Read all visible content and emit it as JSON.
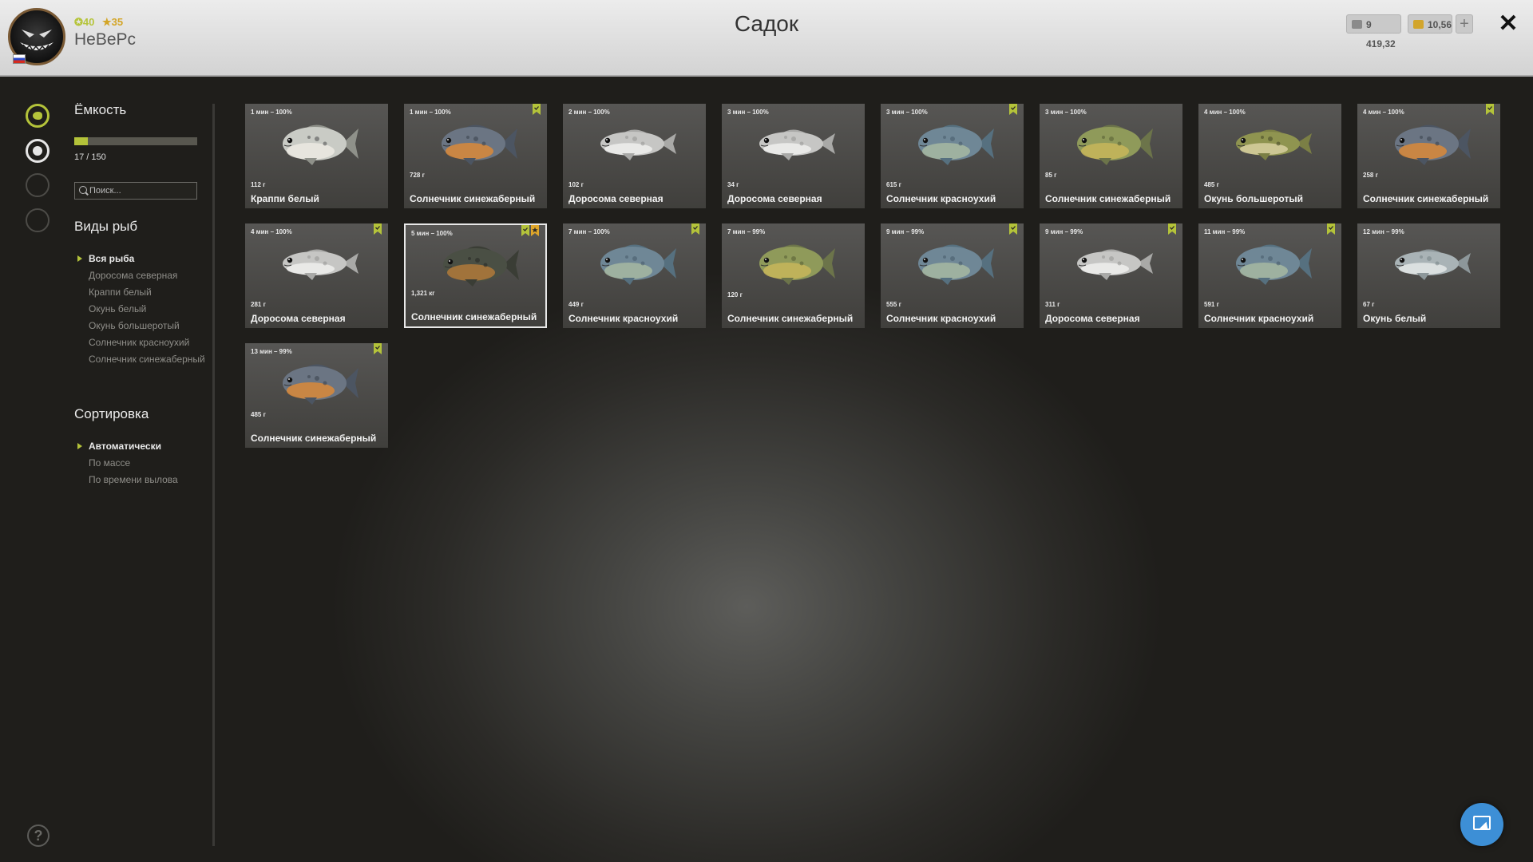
{
  "header": {
    "title": "Садок",
    "player": {
      "name": "НеВеРс",
      "level": "40",
      "rank": "35"
    },
    "currency": {
      "silver": "9 419,32",
      "gold": "10,56"
    },
    "add_label": "+",
    "close_label": "✕"
  },
  "sidebar": {
    "capacity": {
      "title": "Ёмкость",
      "text": "17 / 150",
      "fraction": 0.113
    },
    "search_placeholder": "Поиск...",
    "species": {
      "title": "Виды рыб",
      "items": [
        {
          "label": "Вся рыба",
          "active": true
        },
        {
          "label": "Доросома северная",
          "active": false
        },
        {
          "label": "Краппи белый",
          "active": false
        },
        {
          "label": "Окунь белый",
          "active": false
        },
        {
          "label": "Окунь большеротый",
          "active": false
        },
        {
          "label": "Солнечник красноухий",
          "active": false
        },
        {
          "label": "Солнечник синежаберный",
          "active": false
        }
      ]
    },
    "sort": {
      "title": "Сортировка",
      "items": [
        {
          "label": "Автоматически",
          "active": true
        },
        {
          "label": "По массе",
          "active": false
        },
        {
          "label": "По времени вылова",
          "active": false
        }
      ]
    },
    "help_label": "?"
  },
  "catch": [
    {
      "time": "1 мин – 100%",
      "weight": "112 г",
      "name": "Краппи белый",
      "kind": "crappie",
      "trophy": false,
      "star": false
    },
    {
      "time": "1 мин – 100%",
      "weight": "728 г",
      "name": "Солнечник синежаберный",
      "kind": "bluegill",
      "trophy": true,
      "star": false
    },
    {
      "time": "2 мин – 100%",
      "weight": "102 г",
      "name": "Доросома северная",
      "kind": "shad",
      "trophy": false,
      "star": false
    },
    {
      "time": "3 мин – 100%",
      "weight": "34 г",
      "name": "Доросома северная",
      "kind": "shad",
      "trophy": false,
      "star": false
    },
    {
      "time": "3 мин – 100%",
      "weight": "615 г",
      "name": "Солнечник красноухий",
      "kind": "redear",
      "trophy": true,
      "star": false
    },
    {
      "time": "3 мин – 100%",
      "weight": "85 г",
      "name": "Солнечник синежаберный",
      "kind": "bluegill-green",
      "trophy": false,
      "star": false
    },
    {
      "time": "4 мин – 100%",
      "weight": "485 г",
      "name": "Окунь большеротый",
      "kind": "bass",
      "trophy": false,
      "star": false
    },
    {
      "time": "4 мин – 100%",
      "weight": "258 г",
      "name": "Солнечник синежаберный",
      "kind": "bluegill",
      "trophy": true,
      "star": false
    },
    {
      "time": "4 мин – 100%",
      "weight": "281 г",
      "name": "Доросома северная",
      "kind": "shad",
      "trophy": true,
      "star": false
    },
    {
      "time": "5 мин – 100%",
      "weight": "1,321 кг",
      "name": "Солнечник синежаберный",
      "kind": "bluegill-dark",
      "trophy": true,
      "star": true,
      "selected": true
    },
    {
      "time": "7 мин – 100%",
      "weight": "449 г",
      "name": "Солнечник красноухий",
      "kind": "redear",
      "trophy": true,
      "star": false
    },
    {
      "time": "7 мин – 99%",
      "weight": "120 г",
      "name": "Солнечник синежаберный",
      "kind": "bluegill-green",
      "trophy": false,
      "star": false
    },
    {
      "time": "9 мин – 99%",
      "weight": "555 г",
      "name": "Солнечник красноухий",
      "kind": "redear",
      "trophy": true,
      "star": false
    },
    {
      "time": "9 мин – 99%",
      "weight": "311 г",
      "name": "Доросома северная",
      "kind": "shad",
      "trophy": true,
      "star": false
    },
    {
      "time": "11 мин – 99%",
      "weight": "591 г",
      "name": "Солнечник красноухий",
      "kind": "redear",
      "trophy": true,
      "star": false
    },
    {
      "time": "12 мин – 99%",
      "weight": "67 г",
      "name": "Окунь белый",
      "kind": "whiteperch",
      "trophy": false,
      "star": false
    },
    {
      "time": "13 мин – 99%",
      "weight": "485 г",
      "name": "Солнечник синежаберный",
      "kind": "bluegill",
      "trophy": true,
      "star": false
    }
  ],
  "colors": {
    "accent": "#b4c33a",
    "star": "#e0a72a",
    "selected_border": "#e8e8e8"
  }
}
